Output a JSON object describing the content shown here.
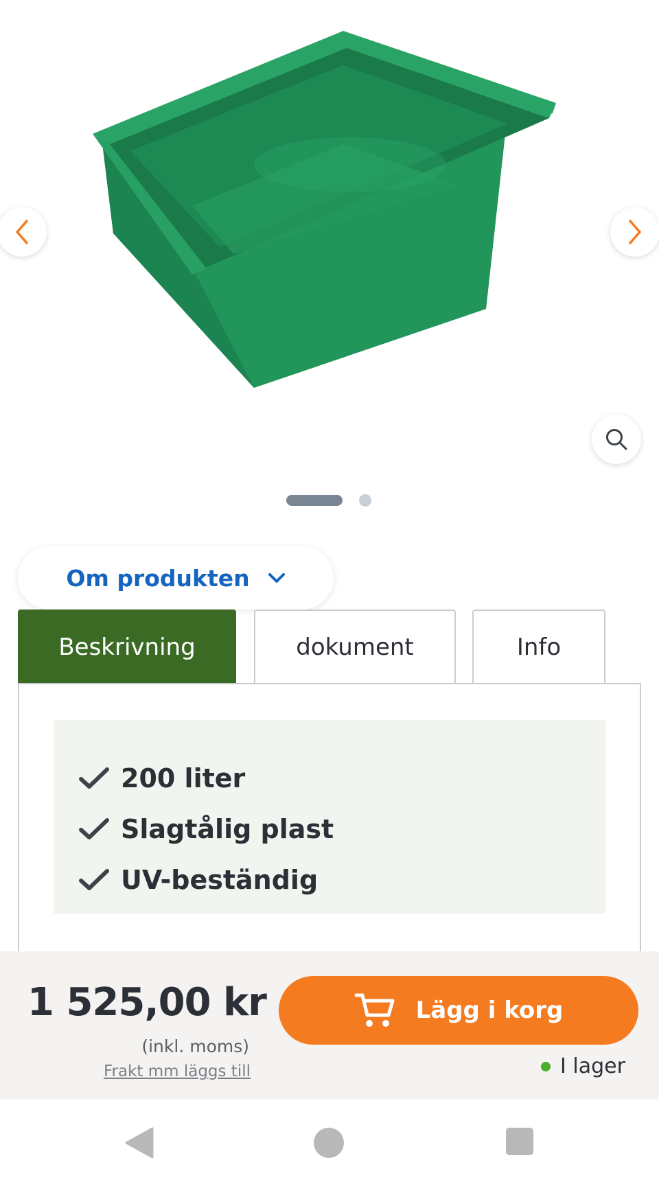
{
  "gallery": {
    "image_alt": "Grön plastlåda",
    "prev_icon": "chevron-left-icon",
    "next_icon": "chevron-right-icon",
    "zoom_icon": "search-icon",
    "slide_count": 2,
    "active_slide": 1
  },
  "about": {
    "label": "Om produkten",
    "icon": "chevron-down-icon"
  },
  "tabs": [
    {
      "label": "Beskrivning",
      "active": true
    },
    {
      "label": "dokument",
      "active": false
    },
    {
      "label": "Info",
      "active": false
    }
  ],
  "features": [
    {
      "text": "200 liter",
      "icon": "check-icon"
    },
    {
      "text": "Slagtålig plast",
      "icon": "check-icon"
    },
    {
      "text": "UV-beständig",
      "icon": "check-icon"
    }
  ],
  "purchase": {
    "price": "1 525,00 kr",
    "vat_note": "(inkl. moms)",
    "shipping_note": "Frakt mm läggs till",
    "cart_label": "Lägg i korg",
    "cart_icon": "cart-icon",
    "stock_label": "I lager"
  },
  "colors": {
    "accent_orange": "#f47b20",
    "active_tab_green": "#3b6a25",
    "link_blue": "#1565c0",
    "stock_green": "#4caf2a"
  }
}
